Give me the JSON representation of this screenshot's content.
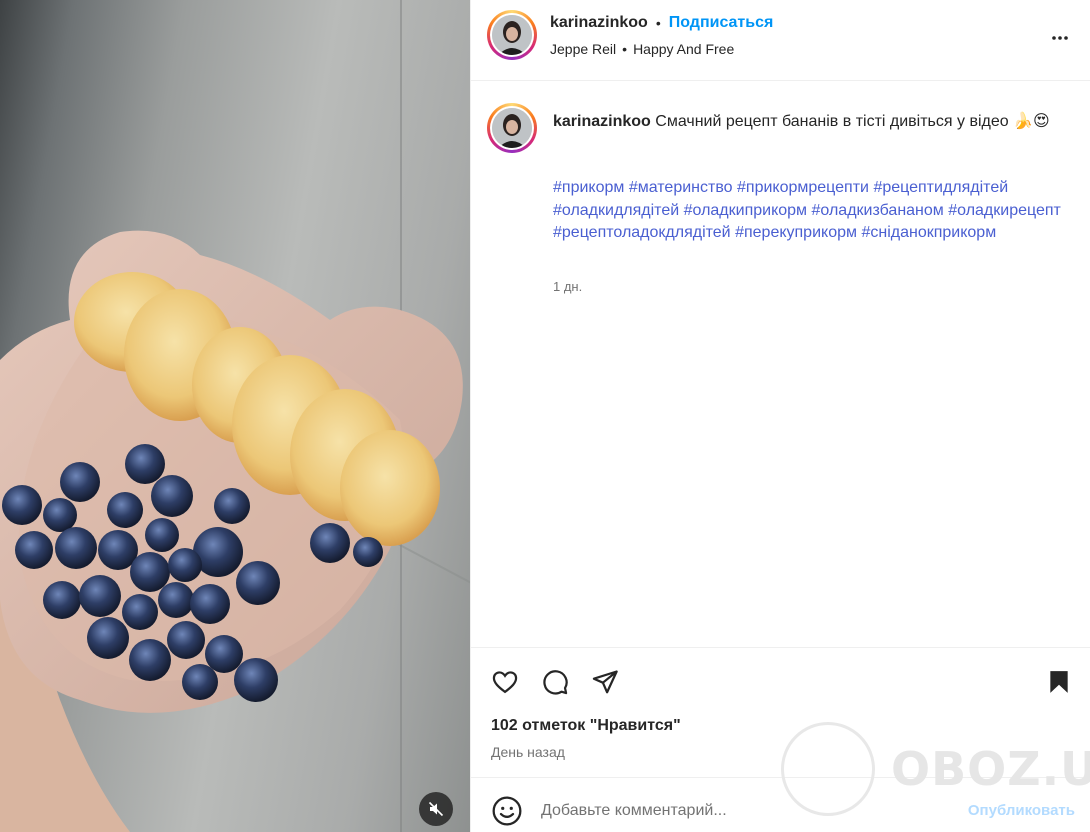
{
  "post": {
    "author": "karinazinkoo",
    "follow_label": "Подписаться",
    "separator": "•",
    "audio_artist": "Jeppe Reil",
    "audio_track": "Happy And Free",
    "caption_text": "Смачний рецепт бананів в тісті дивіться у відео 🍌😍",
    "hashtags": [
      "#прикорм",
      "#материнство",
      "#прикормрецепти",
      "#рецептидлядітей",
      "#оладкидлядітей",
      "#оладкиприкорм",
      "#оладкизбананом",
      "#оладкирецепт",
      "#рецептоладокдлядітей",
      "#перекуприкорм",
      "#сніданокприкорм"
    ],
    "caption_age": "1 дн.",
    "likes_text": "102 отметок \"Нравится\"",
    "posted_when": "День назад"
  },
  "comment": {
    "placeholder": "Добавьте комментарий...",
    "publish_label": "Опубликовать"
  },
  "watermark": {
    "text": "OBOZ.UA"
  },
  "icons": {
    "more": "more-options-icon",
    "like": "heart-icon",
    "comment": "comment-icon",
    "share": "share-icon",
    "save": "bookmark-icon",
    "emoji": "emoji-icon",
    "mute": "muted-speaker-icon"
  },
  "colors": {
    "link": "#0095f6",
    "hashtag": "#4a5fd1",
    "publish_disabled": "#b3dbff",
    "muted_text": "#737373"
  }
}
